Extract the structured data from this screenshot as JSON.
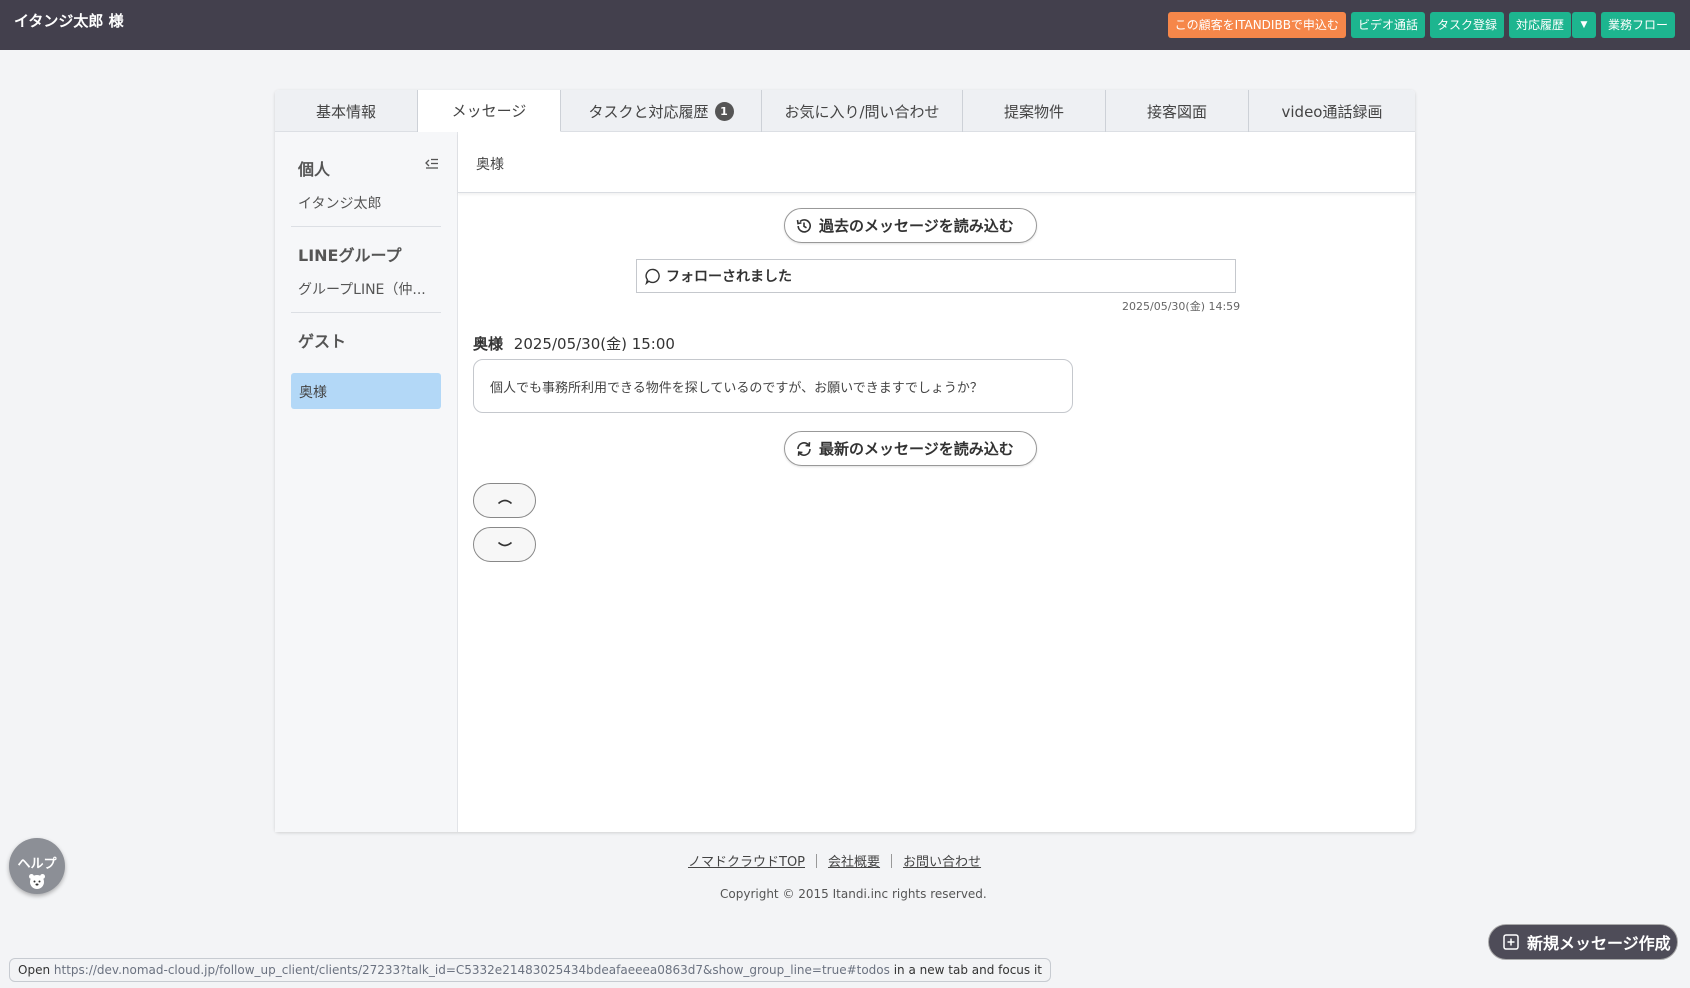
{
  "header": {
    "customer_name": "イタンジ太郎 様",
    "buttons": {
      "apply_itandibb": "この顧客をITANDIBBで申込む",
      "video_call": "ビデオ通話",
      "task_register": "タスク登録",
      "history": "対応履歴",
      "workflow": "業務フロー"
    }
  },
  "tabs": [
    {
      "label": "基本情報"
    },
    {
      "label": "メッセージ"
    },
    {
      "label": "タスクと対応履歴",
      "badge": "1"
    },
    {
      "label": "お気に入り/問い合わせ"
    },
    {
      "label": "提案物件"
    },
    {
      "label": "接客図面"
    },
    {
      "label": "video通話録画"
    }
  ],
  "sidebar": {
    "personal_heading": "個人",
    "personal_item": "イタンジ太郎",
    "line_group_heading": "LINEグループ",
    "line_group_item": "グループLINE（仲...",
    "guest_heading": "ゲスト",
    "guest_item": "奥様"
  },
  "conversation": {
    "title": "奥様",
    "load_older": "過去のメッセージを読み込む",
    "follow_event": "フォローされました",
    "follow_timestamp": "2025/05/30(金) 14:59",
    "message": {
      "sender": "奥様",
      "timestamp": "2025/05/30(金) 15:00",
      "text": "個人でも事務所利用できる物件を探しているのですが、お願いできますでしょうか？"
    },
    "load_newer": "最新のメッセージを読み込む"
  },
  "footer": {
    "links": [
      "ノマドクラウドTOP",
      "会社概要",
      "お問い合わせ"
    ],
    "copyright": "Copyright © 2015 Itandi.inc rights reserved."
  },
  "help_label": "ヘルプ",
  "new_message_button": "新規メッセージ作成",
  "status_bar": {
    "prefix": "Open",
    "url": "https://dev.nomad-cloud.jp/follow_up_client/clients/27233?talk_id=C5332e21483025434bdeafaeeea0863d7&show_group_line=true#todos",
    "suffix": "in a new tab and focus it"
  },
  "colors": {
    "header_bg": "#43404d",
    "orange_button": "#f6874a",
    "green_button": "#1db58f",
    "active_sidebar": "#b3d8f7"
  }
}
